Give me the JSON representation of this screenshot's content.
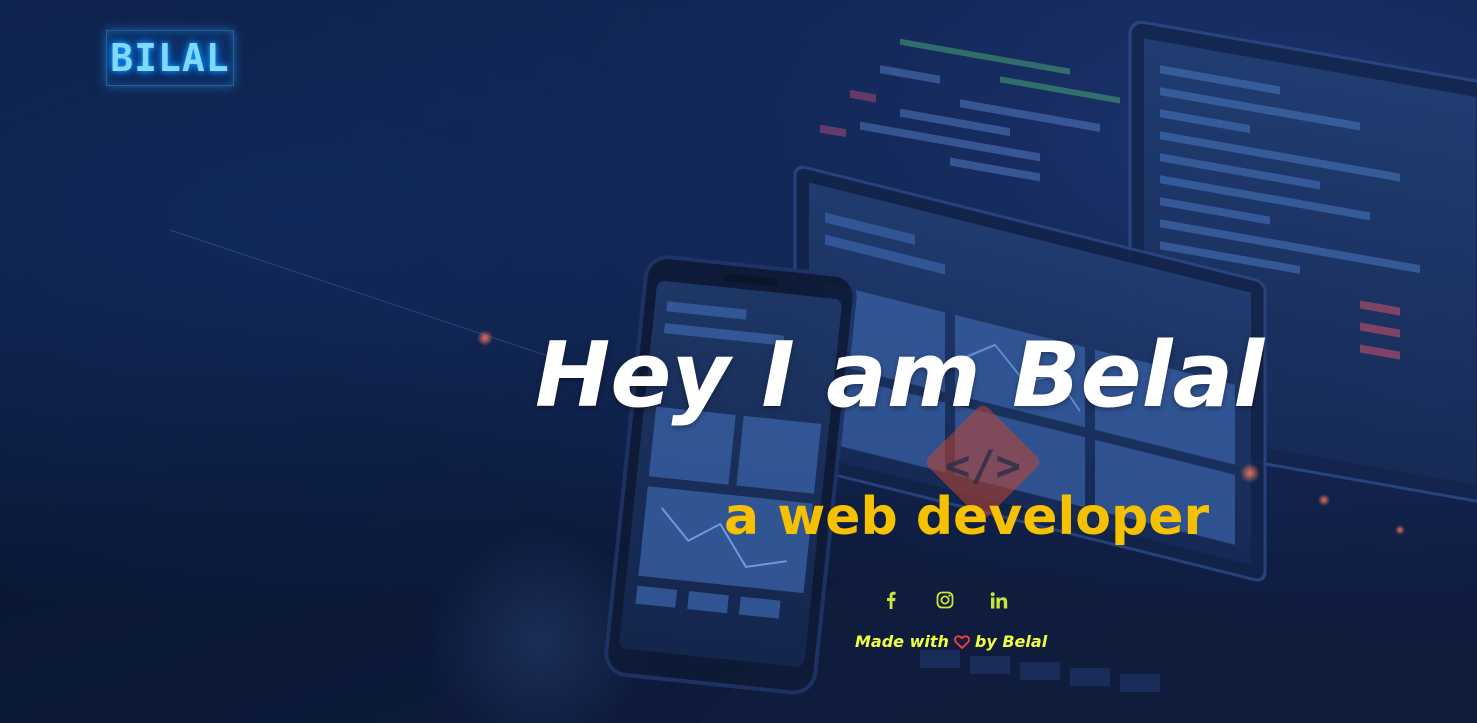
{
  "brand": {
    "logo_text": "BILAL"
  },
  "hero": {
    "headline": "Hey I am Belal",
    "subline": "a web developer"
  },
  "social": [
    {
      "icon": "facebook-icon"
    },
    {
      "icon": "instagram-icon"
    },
    {
      "icon": "linkedin-icon"
    }
  ],
  "footer": {
    "credit_before": "Made with",
    "credit_after": "by Belal"
  },
  "colors": {
    "background": "#0b1a3a",
    "headline": "#ffffff",
    "subline": "#f5c100",
    "social_icon": "#c8e63a",
    "credit": "#eeff41",
    "heart": "#ff3b3b",
    "logo_glow": "#1aa3ff"
  }
}
